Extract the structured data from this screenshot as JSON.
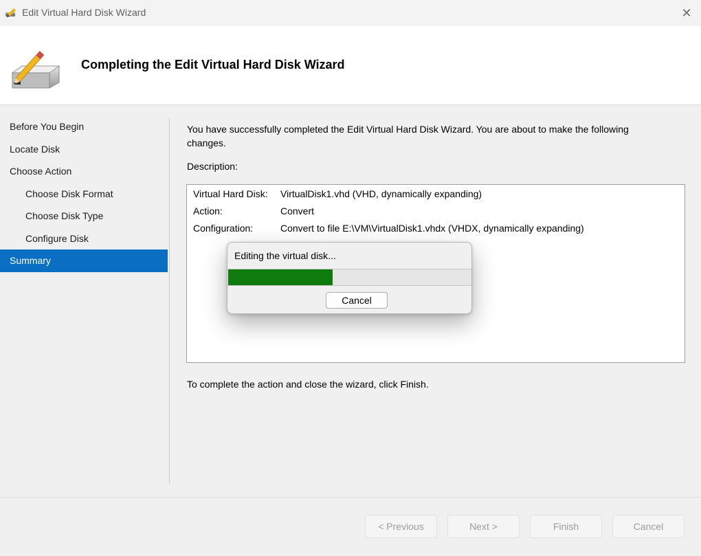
{
  "window": {
    "title": "Edit Virtual Hard Disk Wizard",
    "close_glyph": "✕",
    "app_icon": "disk-pencil-icon"
  },
  "header": {
    "title": "Completing the Edit Virtual Hard Disk Wizard",
    "icon": "disk-pencil-icon"
  },
  "nav": {
    "items": [
      {
        "label": "Before You Begin",
        "indent": false,
        "selected": false
      },
      {
        "label": "Locate Disk",
        "indent": false,
        "selected": false
      },
      {
        "label": "Choose Action",
        "indent": false,
        "selected": false
      },
      {
        "label": "Choose Disk Format",
        "indent": true,
        "selected": false
      },
      {
        "label": "Choose Disk Type",
        "indent": true,
        "selected": false
      },
      {
        "label": "Configure Disk",
        "indent": true,
        "selected": false
      },
      {
        "label": "Summary",
        "indent": false,
        "selected": true
      }
    ]
  },
  "main": {
    "intro": "You have successfully completed the Edit Virtual Hard Disk Wizard. You are about to make the following changes.",
    "description_label": "Description:",
    "description_rows": [
      {
        "key": "Virtual Hard Disk:",
        "value": "VirtualDisk1.vhd (VHD, dynamically expanding)"
      },
      {
        "key": "Action:",
        "value": "Convert"
      },
      {
        "key": "Configuration:",
        "value": "Convert to file E:\\VM\\VirtualDisk1.vhdx (VHDX, dynamically expanding)"
      }
    ],
    "finish_note": "To complete the action and close the wizard, click Finish."
  },
  "footer": {
    "previous": "< Previous",
    "next": "Next >",
    "finish": "Finish",
    "cancel": "Cancel"
  },
  "progress_dialog": {
    "label": "Editing the virtual disk...",
    "progress": 0.43,
    "cancel": "Cancel"
  },
  "colors": {
    "selection": "#0a6fc2",
    "progress": "#0f7b0f"
  }
}
